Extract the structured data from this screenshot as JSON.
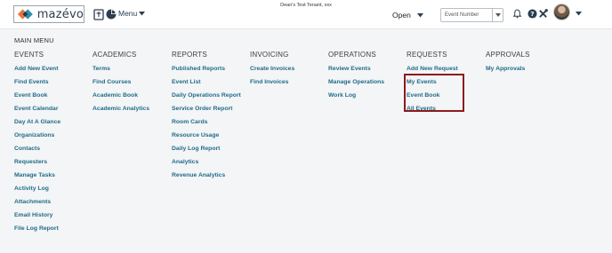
{
  "header": {
    "logo_text": "mazévo",
    "menu_label": "Menu",
    "tenant": "Dean's Test Tenant, xxx",
    "status_value": "Open",
    "search_placeholder": "Event Number",
    "icons": [
      "calendar-icon",
      "pie-chart-icon",
      "bell-icon",
      "help-icon",
      "tools-icon",
      "avatar",
      "chevron-down-icon"
    ]
  },
  "main_menu": {
    "title": "MAIN MENU",
    "columns": [
      {
        "heading": "EVENTS",
        "items": [
          "Add New Event",
          "Find Events",
          "Event Book",
          "Event Calendar",
          "Day At A Glance",
          "Organizations",
          "Contacts",
          "Requesters",
          "Manage Tasks",
          "Activity Log",
          "Attachments",
          "Email History",
          "File Log Report"
        ]
      },
      {
        "heading": "ACADEMICS",
        "items": [
          "Terms",
          "Find Courses",
          "Academic Book",
          "Academic Analytics"
        ]
      },
      {
        "heading": "REPORTS",
        "items": [
          "Published Reports",
          "Event List",
          "Daily Operations Report",
          "Service Order Report",
          "Room Cards",
          "Resource Usage",
          "Daily Log Report",
          "Analytics",
          "Revenue Analytics"
        ]
      },
      {
        "heading": "INVOICING",
        "items": [
          "Create Invoices",
          "Find Invoices"
        ]
      },
      {
        "heading": "OPERATIONS",
        "items": [
          "Review Events",
          "Manage Operations",
          "Work Log"
        ]
      },
      {
        "heading": "REQUESTS",
        "items": [
          "Add New Request",
          "My Events",
          "Event Book",
          "All Events"
        ]
      },
      {
        "heading": "APPROVALS",
        "items": [
          "My Approvals"
        ]
      }
    ]
  },
  "colors": {
    "link": "#1f6b8a",
    "highlight_border": "#8c1b1b",
    "background": "#f4f5f6"
  }
}
